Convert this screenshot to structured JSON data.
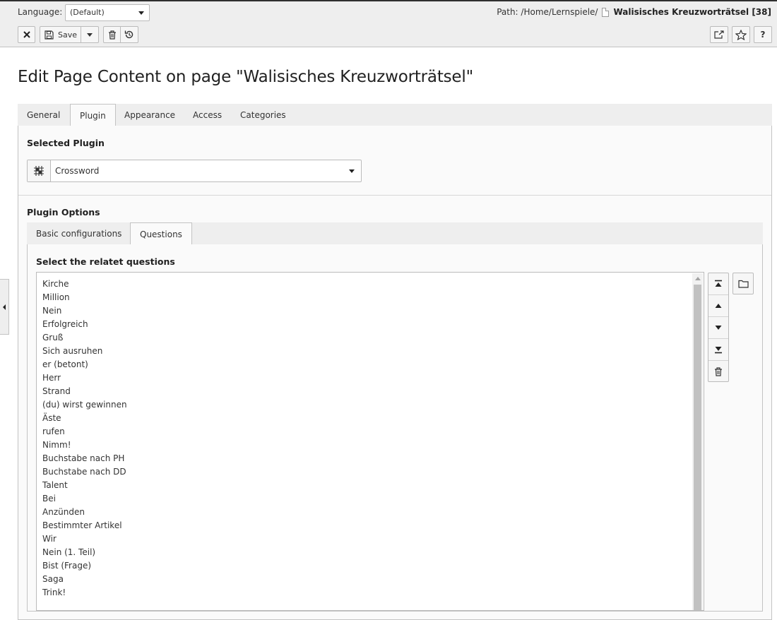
{
  "header": {
    "language_label": "Language:",
    "language_value": "(Default)",
    "path_label": "Path:",
    "path_value": "/Home/Lernspiele/",
    "page_title": "Walisisches Kreuzworträtsel [38]"
  },
  "toolbar": {
    "close_icon": "close-icon",
    "save_label": "Save",
    "save_icon": "floppy-disk-icon",
    "save_dropdown_icon": "chevron-down-icon",
    "delete_icon": "trash-icon",
    "history_icon": "history-icon",
    "open_new_window_icon": "external-link-icon",
    "bookmark_icon": "star-icon",
    "help_label": "?"
  },
  "heading": "Edit Page Content on page \"Walisisches Kreuzworträtsel\"",
  "tabs": [
    {
      "label": "General"
    },
    {
      "label": "Plugin",
      "active": true
    },
    {
      "label": "Appearance"
    },
    {
      "label": "Access"
    },
    {
      "label": "Categories"
    }
  ],
  "plugin": {
    "selected_label": "Selected Plugin",
    "selected_value": "Crossword",
    "icon": "crossword-grid-icon",
    "options_label": "Plugin Options"
  },
  "subtabs": [
    {
      "label": "Basic configurations"
    },
    {
      "label": "Questions",
      "active": true
    }
  ],
  "questions": {
    "label": "Select the relatet questions",
    "items": [
      "Kirche",
      "Million",
      "Nein",
      "Erfolgreich",
      "Gruß",
      "Sich ausruhen",
      "er (betont)",
      "Herr",
      "Strand",
      "(du) wirst gewinnen",
      "Äste",
      "rufen",
      "Nimm!",
      "Buchstabe nach PH",
      "Buchstabe nach DD",
      "Talent",
      "Bei",
      "Anzünden",
      "Bestimmter Artikel",
      "Wir",
      "Nein (1. Teil)",
      "Bist (Frage)",
      "Saga",
      "Trink!"
    ],
    "controls": [
      "move-to-top-icon",
      "move-up-icon",
      "move-down-icon",
      "move-to-bottom-icon",
      "delete-icon"
    ],
    "browse_icon": "folder-icon"
  },
  "colors": {
    "header_bg": "#eeeeee",
    "panel_bg": "#fafafa",
    "border": "#c3c3c3"
  }
}
